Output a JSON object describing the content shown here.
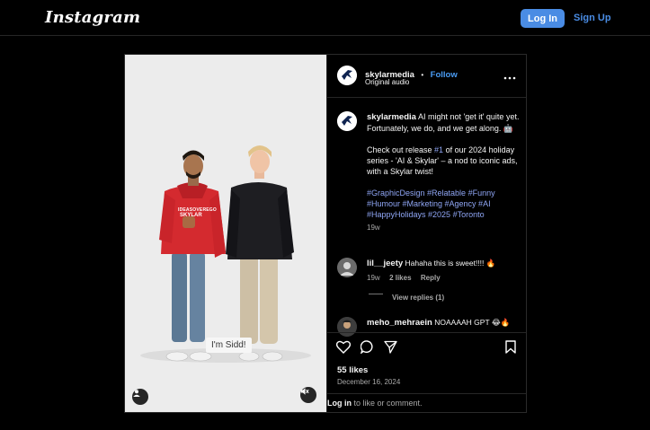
{
  "topbar": {
    "logo": "Instagram",
    "login_label": "Log In",
    "signup_label": "Sign Up"
  },
  "media": {
    "caption": "I'm Sidd!",
    "hoodie_text_1": "IDEASOVEREGO",
    "hoodie_text_2": "SKYLAR"
  },
  "post_header": {
    "username": "skylarmedia",
    "separator": "•",
    "follow_label": "Follow",
    "audio": "Original audio"
  },
  "caption": {
    "username": "skylarmedia",
    "line1": "AI might not 'get it' quite yet. Fortunately, we do, and we get along. 🤖",
    "line2_prefix": "Check out release ",
    "line2_tag": "#1",
    "line2_suffix": " of our 2024 holiday series - 'AI & Skylar'  – a nod to iconic ads, with a Skylar twist!",
    "hashtags": "#GraphicDesign #Relatable #Funny #Humour #Marketing #Agency #AI #HappyHolidays #2025 #Toronto",
    "age": "19w"
  },
  "comments": [
    {
      "username": "lil__jeety",
      "text": "Hahaha this is sweet!!!! 🔥",
      "age": "19w",
      "likes": "2 likes",
      "reply": "Reply",
      "view_replies": "View replies (1)"
    },
    {
      "username": "meho_mehraein",
      "text": "NOAAAAH GPT 😂🔥"
    }
  ],
  "stats": {
    "likes": "55 likes",
    "date": "December 16, 2024"
  },
  "footer": {
    "login_link": "Log in",
    "suffix": " to like or comment."
  },
  "colors": {
    "accent": "#4a8ce4",
    "background": "#000000",
    "hashtag": "#8fa6f5"
  }
}
